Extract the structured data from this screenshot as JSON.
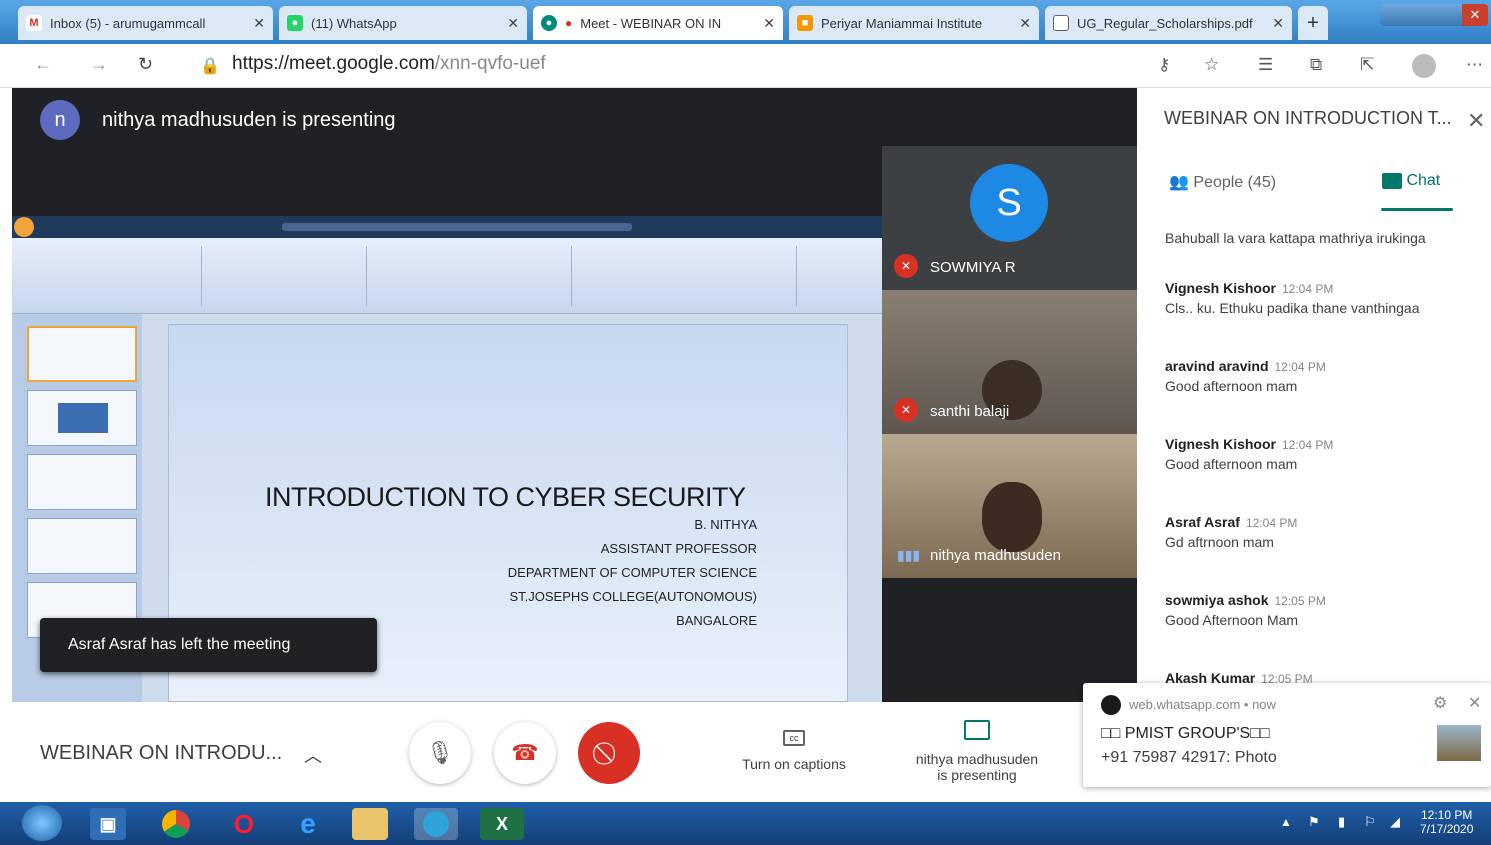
{
  "browser": {
    "tabs": [
      {
        "label": "Inbox (5) - arumugammcall",
        "icon": "gmail-icon",
        "color": "#d93025",
        "glyph": "M"
      },
      {
        "label": "(11) WhatsApp",
        "icon": "whatsapp-icon",
        "color": "#25d366",
        "glyph": "●"
      },
      {
        "label": "Meet - WEBINAR ON IN",
        "icon": "meet-icon",
        "color": "#00897b",
        "glyph": "●"
      },
      {
        "label": "Periyar Maniammai Institute",
        "icon": "university-icon",
        "color": "#f29900",
        "glyph": "■"
      },
      {
        "label": "UG_Regular_Scholarships.pdf",
        "icon": "document-icon",
        "color": "#5f6368",
        "glyph": "□"
      }
    ],
    "new_tab": "+",
    "url_host": "https://meet.google.com",
    "url_path": "/xnn-qvfo-uef"
  },
  "presentation": {
    "presenter_initial": "n",
    "presenting_label": "nithya madhusuden is presenting",
    "slide": {
      "title": "INTRODUCTION TO CYBER SECURITY",
      "lines": [
        "B. NITHYA",
        "ASSISTANT PROFESSOR",
        "DEPARTMENT OF COMPUTER SCIENCE",
        "ST.JOSEPHS COLLEGE(AUTONOMOUS)",
        "BANGALORE"
      ]
    },
    "toast": "Asraf Asraf has left the meeting"
  },
  "participants": [
    {
      "name": "SOWMIYA R",
      "initial": "S",
      "muted": true
    },
    {
      "name": "santhi balaji",
      "muted": true
    },
    {
      "name": "nithya madhusuden",
      "speaking": true
    }
  ],
  "panel": {
    "title": "WEBINAR ON INTRODUCTION T...",
    "people_tab": "People (45)",
    "chat_tab": "Chat",
    "messages": [
      {
        "text": "Bahuball la vara kattapa mathriya irukinga"
      },
      {
        "sender": "Vignesh Kishoor",
        "time": "12:04 PM",
        "text": "Cls.. ku. Ethuku padika thane vanthingaa"
      },
      {
        "sender": "aravind aravind",
        "time": "12:04 PM",
        "text": "Good afternoon mam"
      },
      {
        "sender": "Vignesh Kishoor",
        "time": "12:04 PM",
        "text": "Good afternoon mam"
      },
      {
        "sender": "Asraf Asraf",
        "time": "12:04 PM",
        "text": "Gd aftrnoon mam"
      },
      {
        "sender": "sowmiya ashok",
        "time": "12:05 PM",
        "text": "Good Afternoon Mam"
      },
      {
        "sender": "Akash Kumar",
        "time": "12:05 PM"
      }
    ]
  },
  "bottom_bar": {
    "meeting_name": "WEBINAR ON INTRODU...",
    "captions_label": "Turn on captions",
    "presenting_line1": "nithya madhusuden",
    "presenting_line2": "is presenting"
  },
  "notification": {
    "source": "web.whatsapp.com",
    "when": "now",
    "title": "□□ PMIST GROUP'S□□",
    "body": "+91 75987 42917: Photo"
  },
  "taskbar": {
    "time": "12:10 PM",
    "date": "7/17/2020"
  },
  "colors": {
    "meet_teal": "#00796b",
    "end_call": "#d93025",
    "stage_bg": "#202124"
  }
}
